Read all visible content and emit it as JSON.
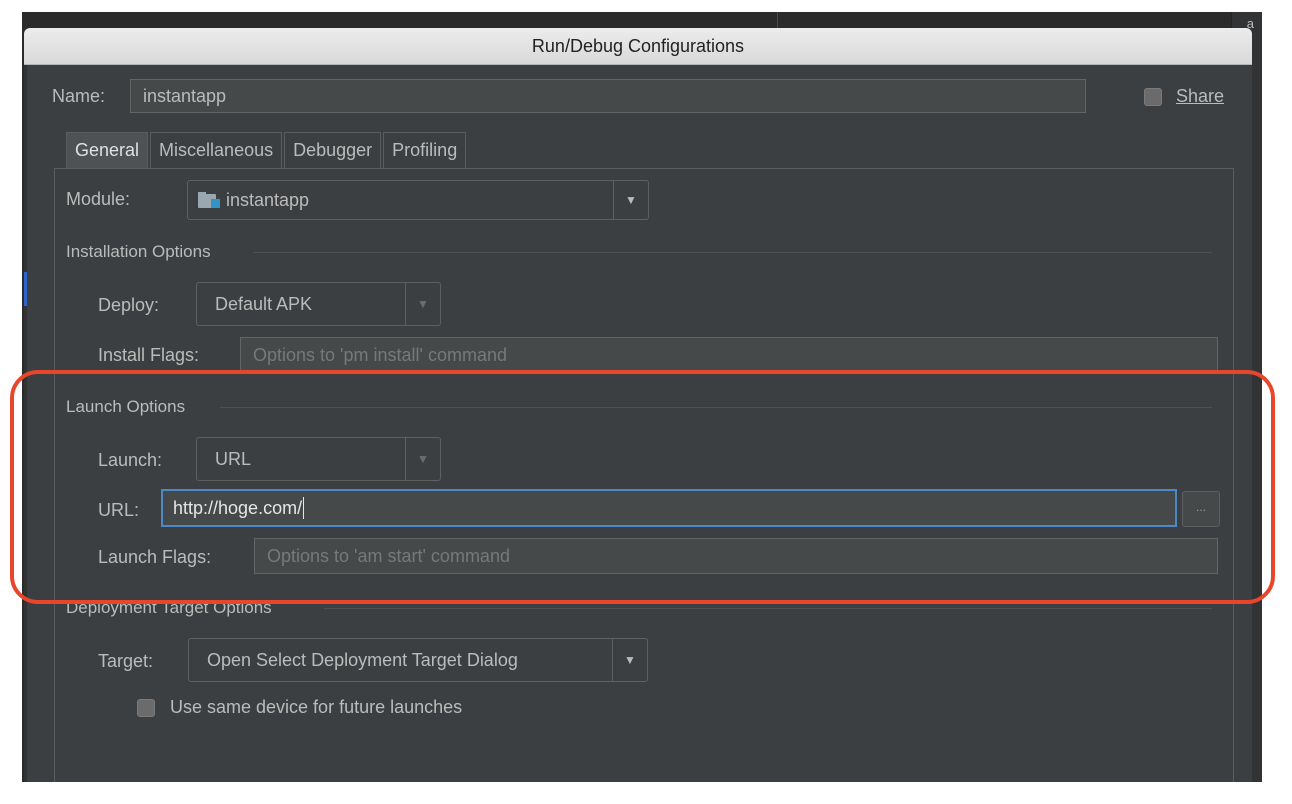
{
  "window": {
    "title": "Run/Debug Configurations"
  },
  "background": {
    "side_glyph": "a"
  },
  "name_row": {
    "label": "Name:",
    "value": "instantapp",
    "share_label": "Share"
  },
  "tabs": [
    {
      "label": "General"
    },
    {
      "label": "Miscellaneous"
    },
    {
      "label": "Debugger"
    },
    {
      "label": "Profiling"
    }
  ],
  "module": {
    "label": "Module:",
    "value": "instantapp",
    "icon": "folder-icon"
  },
  "installation": {
    "section_title": "Installation Options",
    "deploy_label": "Deploy:",
    "deploy_value": "Default APK",
    "flags_label": "Install Flags:",
    "flags_placeholder": "Options to 'pm install' command"
  },
  "launch": {
    "section_title": "Launch Options",
    "launch_label": "Launch:",
    "launch_value": "URL",
    "url_label": "URL:",
    "url_value": "http://hoge.com/",
    "browse_label": "...",
    "flags_label": "Launch Flags:",
    "flags_placeholder": "Options to 'am start' command"
  },
  "deployment": {
    "section_title": "Deployment Target Options",
    "target_label": "Target:",
    "target_value": "Open Select Deployment Target Dialog",
    "same_device_label": "Use same device for future launches"
  },
  "colors": {
    "dialog_bg": "#3c3f41",
    "text": "#bbbbbb",
    "focus": "#4a88c7",
    "highlight": "#e7452c"
  }
}
